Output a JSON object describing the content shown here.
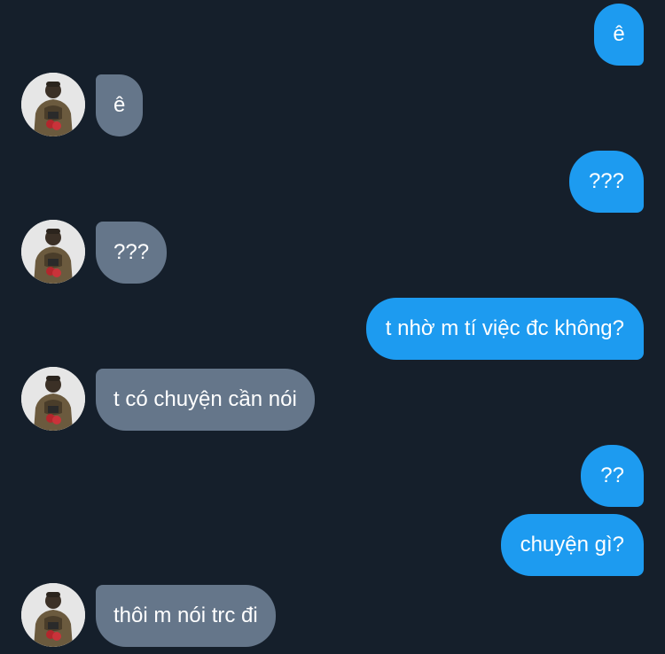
{
  "messages": [
    {
      "side": "out",
      "text": "ê"
    },
    {
      "side": "in",
      "text": "ê"
    },
    {
      "side": "out",
      "text": "???"
    },
    {
      "side": "in",
      "text": "???"
    },
    {
      "side": "out",
      "text": "t nhờ m tí việc đc không?"
    },
    {
      "side": "in",
      "text": "t có chuyện cần nói"
    },
    {
      "side": "out",
      "text": "??"
    },
    {
      "side": "out",
      "text": "chuyện gì?"
    },
    {
      "side": "in",
      "text": "thôi m nói trc đi"
    }
  ],
  "colors": {
    "background": "#151f2b",
    "outgoing_bubble": "#1d9bf0",
    "incoming_bubble": "#65768a",
    "text": "#ffffff"
  }
}
